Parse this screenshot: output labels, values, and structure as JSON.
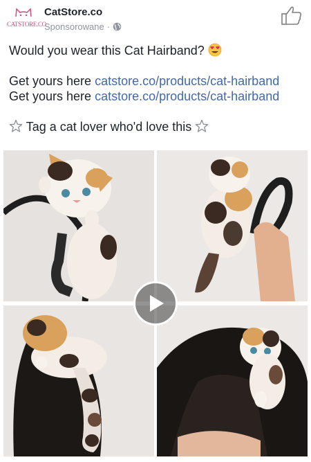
{
  "header": {
    "page_name": "CatStore.co",
    "logo_text": "CATSTORE.CO",
    "sponsored_label": "Sponsorowane",
    "separator": "·"
  },
  "post": {
    "question": "Would you wear this Cat Hairband?",
    "get_yours_prefix": "Get yours here",
    "link_1": "catstore.co/products/cat-hairband",
    "link_2": "catstore.co/products/cat-hairband",
    "tag_text": "Tag a cat lover who'd love this"
  },
  "icons": {
    "globe": "globe-icon",
    "like": "thumbs-up-icon",
    "emoji": "heart-eyes-emoji-icon",
    "star": "star-outline-icon",
    "play": "play-icon"
  },
  "colors": {
    "link": "#4267b2",
    "logo_pink": "#e0457b",
    "meta_gray": "#90949c"
  }
}
